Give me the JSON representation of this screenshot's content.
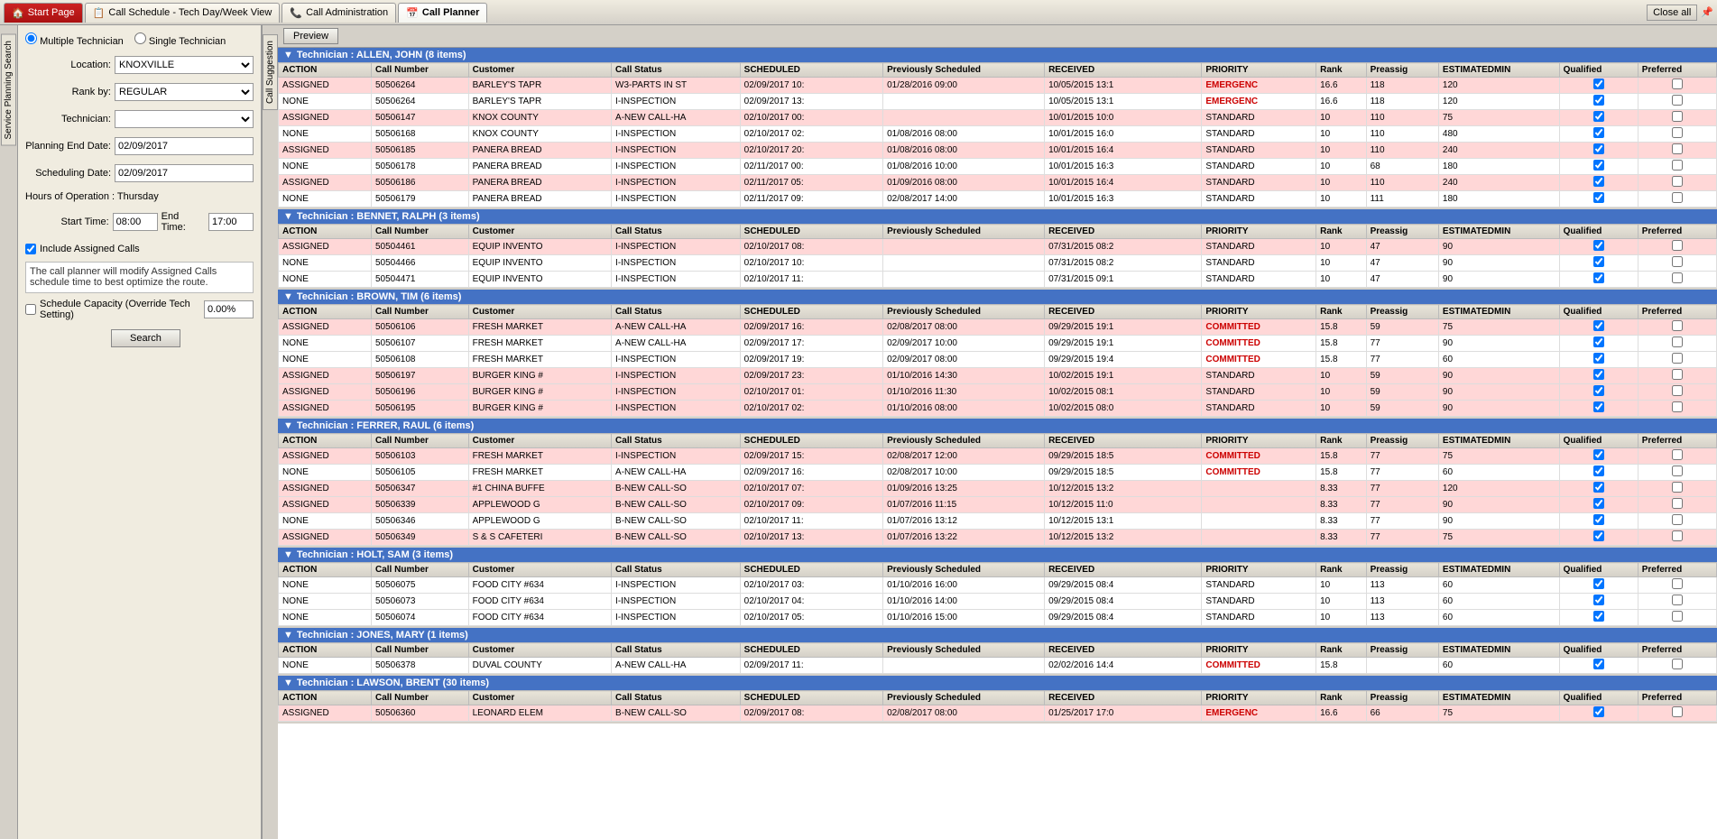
{
  "tabs": [
    {
      "label": "Start Page",
      "id": "start",
      "icon": "🏠",
      "active": false,
      "isStart": true
    },
    {
      "label": "Call Schedule - Tech Day/Week View",
      "id": "callschedule",
      "active": false
    },
    {
      "label": "Call Administration",
      "id": "calladmin",
      "active": false
    },
    {
      "label": "Call Planner",
      "id": "callplanner",
      "active": true
    }
  ],
  "closeAllLabel": "Close all",
  "previewLabel": "Preview",
  "sidebar": {
    "servicePlanning": "Service Planning Search",
    "callSuggestion": "Call Suggestion"
  },
  "leftPanel": {
    "multiTechLabel": "Multiple Technician",
    "singleTechLabel": "Single Technician",
    "locationLabel": "Location:",
    "locationValue": "KNOXVILLE",
    "rankByLabel": "Rank by:",
    "rankByValue": "REGULAR",
    "technicianLabel": "Technician:",
    "planningEndDateLabel": "Planning End Date:",
    "planningEndDateValue": "02/09/2017",
    "schedulingDateLabel": "Scheduling Date:",
    "schedulingDateValue": "02/09/2017",
    "hoursOfOperationLabel": "Hours of Operation : Thursday",
    "startTimeLabel": "Start Time:",
    "startTimeValue": "08:00",
    "endTimeLabel": "End Time:",
    "endTimeValue": "17:00",
    "includeAssignedLabel": "Include Assigned Calls",
    "infoBoxText": "The call planner will modify Assigned Calls schedule time to best optimize the route.",
    "scheduleCapacityLabel": "Schedule Capacity (Override Tech Setting)",
    "scheduleCapacityValue": "0.00%",
    "searchLabel": "Search"
  },
  "technicians": [
    {
      "name": "ALLEN, JOHN",
      "itemCount": 8,
      "rows": [
        {
          "action": "ASSIGNED",
          "callNum": "50506264",
          "customer": "BARLEY'S TAPR",
          "callStatus": "W3-PARTS IN ST",
          "scheduled": "02/09/2017 10:",
          "prevScheduled": "01/28/2016 09:00",
          "received": "10/05/2015 13:1",
          "priority": "EMERGENC",
          "rank": "16.6",
          "preassig": "118",
          "estMin": "120",
          "qualified": true,
          "preferred": false,
          "rowType": "assigned"
        },
        {
          "action": "NONE",
          "callNum": "50506264",
          "customer": "BARLEY'S TAPR",
          "callStatus": "I-INSPECTION",
          "scheduled": "02/09/2017 13:",
          "prevScheduled": "",
          "received": "10/05/2015 13:1",
          "priority": "EMERGENC",
          "rank": "16.6",
          "preassig": "118",
          "estMin": "120",
          "qualified": true,
          "preferred": false,
          "rowType": "none"
        },
        {
          "action": "ASSIGNED",
          "callNum": "50506147",
          "customer": "KNOX COUNTY",
          "callStatus": "A-NEW CALL-HA",
          "scheduled": "02/10/2017 00:",
          "prevScheduled": "",
          "received": "10/01/2015 10:0",
          "priority": "STANDARD",
          "rank": "10",
          "preassig": "110",
          "estMin": "75",
          "qualified": true,
          "preferred": false,
          "rowType": "assigned"
        },
        {
          "action": "NONE",
          "callNum": "50506168",
          "customer": "KNOX COUNTY",
          "callStatus": "I-INSPECTION",
          "scheduled": "02/10/2017 02:",
          "prevScheduled": "01/08/2016 08:00",
          "received": "10/01/2015 16:0",
          "priority": "STANDARD",
          "rank": "10",
          "preassig": "110",
          "estMin": "480",
          "qualified": true,
          "preferred": false,
          "rowType": "none"
        },
        {
          "action": "ASSIGNED",
          "callNum": "50506185",
          "customer": "PANERA BREAD",
          "callStatus": "I-INSPECTION",
          "scheduled": "02/10/2017 20:",
          "prevScheduled": "01/08/2016 08:00",
          "received": "10/01/2015 16:4",
          "priority": "STANDARD",
          "rank": "10",
          "preassig": "110",
          "estMin": "240",
          "qualified": true,
          "preferred": false,
          "rowType": "assigned"
        },
        {
          "action": "NONE",
          "callNum": "50506178",
          "customer": "PANERA BREAD",
          "callStatus": "I-INSPECTION",
          "scheduled": "02/11/2017 00:",
          "prevScheduled": "01/08/2016 10:00",
          "received": "10/01/2015 16:3",
          "priority": "STANDARD",
          "rank": "10",
          "preassig": "68",
          "estMin": "180",
          "qualified": true,
          "preferred": false,
          "rowType": "none"
        },
        {
          "action": "ASSIGNED",
          "callNum": "50506186",
          "customer": "PANERA BREAD",
          "callStatus": "I-INSPECTION",
          "scheduled": "02/11/2017 05:",
          "prevScheduled": "01/09/2016 08:00",
          "received": "10/01/2015 16:4",
          "priority": "STANDARD",
          "rank": "10",
          "preassig": "110",
          "estMin": "240",
          "qualified": true,
          "preferred": false,
          "rowType": "assigned"
        },
        {
          "action": "NONE",
          "callNum": "50506179",
          "customer": "PANERA BREAD",
          "callStatus": "I-INSPECTION",
          "scheduled": "02/11/2017 09:",
          "prevScheduled": "02/08/2017 14:00",
          "received": "10/01/2015 16:3",
          "priority": "STANDARD",
          "rank": "10",
          "preassig": "111",
          "estMin": "180",
          "qualified": true,
          "preferred": false,
          "rowType": "none"
        }
      ]
    },
    {
      "name": "BENNET, RALPH",
      "itemCount": 3,
      "rows": [
        {
          "action": "ASSIGNED",
          "callNum": "50504461",
          "customer": "EQUIP INVENTO",
          "callStatus": "I-INSPECTION",
          "scheduled": "02/10/2017 08:",
          "prevScheduled": "",
          "received": "07/31/2015 08:2",
          "priority": "STANDARD",
          "rank": "10",
          "preassig": "47",
          "estMin": "90",
          "qualified": true,
          "preferred": false,
          "rowType": "assigned"
        },
        {
          "action": "NONE",
          "callNum": "50504466",
          "customer": "EQUIP INVENTO",
          "callStatus": "I-INSPECTION",
          "scheduled": "02/10/2017 10:",
          "prevScheduled": "",
          "received": "07/31/2015 08:2",
          "priority": "STANDARD",
          "rank": "10",
          "preassig": "47",
          "estMin": "90",
          "qualified": true,
          "preferred": false,
          "rowType": "none"
        },
        {
          "action": "NONE",
          "callNum": "50504471",
          "customer": "EQUIP INVENTO",
          "callStatus": "I-INSPECTION",
          "scheduled": "02/10/2017 11:",
          "prevScheduled": "",
          "received": "07/31/2015 09:1",
          "priority": "STANDARD",
          "rank": "10",
          "preassig": "47",
          "estMin": "90",
          "qualified": true,
          "preferred": false,
          "rowType": "none"
        }
      ]
    },
    {
      "name": "BROWN, TIM",
      "itemCount": 6,
      "rows": [
        {
          "action": "ASSIGNED",
          "callNum": "50506106",
          "customer": "FRESH MARKET",
          "callStatus": "A-NEW CALL-HA",
          "scheduled": "02/09/2017 16:",
          "prevScheduled": "02/08/2017 08:00",
          "received": "09/29/2015 19:1",
          "priority": "COMMITTED",
          "rank": "15.8",
          "preassig": "59",
          "estMin": "75",
          "qualified": true,
          "preferred": false,
          "rowType": "assigned"
        },
        {
          "action": "NONE",
          "callNum": "50506107",
          "customer": "FRESH MARKET",
          "callStatus": "A-NEW CALL-HA",
          "scheduled": "02/09/2017 17:",
          "prevScheduled": "02/09/2017 10:00",
          "received": "09/29/2015 19:1",
          "priority": "COMMITTED",
          "rank": "15.8",
          "preassig": "77",
          "estMin": "90",
          "qualified": true,
          "preferred": false,
          "rowType": "none"
        },
        {
          "action": "NONE",
          "callNum": "50506108",
          "customer": "FRESH MARKET",
          "callStatus": "I-INSPECTION",
          "scheduled": "02/09/2017 19:",
          "prevScheduled": "02/09/2017 08:00",
          "received": "09/29/2015 19:4",
          "priority": "COMMITTED",
          "rank": "15.8",
          "preassig": "77",
          "estMin": "60",
          "qualified": true,
          "preferred": false,
          "rowType": "none"
        },
        {
          "action": "ASSIGNED",
          "callNum": "50506197",
          "customer": "BURGER KING #",
          "callStatus": "I-INSPECTION",
          "scheduled": "02/09/2017 23:",
          "prevScheduled": "01/10/2016 14:30",
          "received": "10/02/2015 19:1",
          "priority": "STANDARD",
          "rank": "10",
          "preassig": "59",
          "estMin": "90",
          "qualified": true,
          "preferred": false,
          "rowType": "assigned"
        },
        {
          "action": "ASSIGNED",
          "callNum": "50506196",
          "customer": "BURGER KING #",
          "callStatus": "I-INSPECTION",
          "scheduled": "02/10/2017 01:",
          "prevScheduled": "01/10/2016 11:30",
          "received": "10/02/2015 08:1",
          "priority": "STANDARD",
          "rank": "10",
          "preassig": "59",
          "estMin": "90",
          "qualified": true,
          "preferred": false,
          "rowType": "assigned"
        },
        {
          "action": "ASSIGNED",
          "callNum": "50506195",
          "customer": "BURGER KING #",
          "callStatus": "I-INSPECTION",
          "scheduled": "02/10/2017 02:",
          "prevScheduled": "01/10/2016 08:00",
          "received": "10/02/2015 08:0",
          "priority": "STANDARD",
          "rank": "10",
          "preassig": "59",
          "estMin": "90",
          "qualified": true,
          "preferred": false,
          "rowType": "assigned"
        }
      ]
    },
    {
      "name": "FERRER, RAUL",
      "itemCount": 6,
      "rows": [
        {
          "action": "ASSIGNED",
          "callNum": "50506103",
          "customer": "FRESH MARKET",
          "callStatus": "I-INSPECTION",
          "scheduled": "02/09/2017 15:",
          "prevScheduled": "02/08/2017 12:00",
          "received": "09/29/2015 18:5",
          "priority": "COMMITTED",
          "rank": "15.8",
          "preassig": "77",
          "estMin": "75",
          "qualified": true,
          "preferred": false,
          "rowType": "assigned"
        },
        {
          "action": "NONE",
          "callNum": "50506105",
          "customer": "FRESH MARKET",
          "callStatus": "A-NEW CALL-HA",
          "scheduled": "02/09/2017 16:",
          "prevScheduled": "02/08/2017 10:00",
          "received": "09/29/2015 18:5",
          "priority": "COMMITTED",
          "rank": "15.8",
          "preassig": "77",
          "estMin": "60",
          "qualified": true,
          "preferred": false,
          "rowType": "none"
        },
        {
          "action": "ASSIGNED",
          "callNum": "50506347",
          "customer": "#1 CHINA BUFFE",
          "callStatus": "B-NEW CALL-SO",
          "scheduled": "02/10/2017 07:",
          "prevScheduled": "01/09/2016 13:25",
          "received": "10/12/2015 13:2",
          "priority": "",
          "rank": "8.33",
          "preassig": "77",
          "estMin": "120",
          "qualified": true,
          "preferred": false,
          "rowType": "assigned"
        },
        {
          "action": "ASSIGNED",
          "callNum": "50506339",
          "customer": "APPLEWOOD G",
          "callStatus": "B-NEW CALL-SO",
          "scheduled": "02/10/2017 09:",
          "prevScheduled": "01/07/2016 11:15",
          "received": "10/12/2015 11:0",
          "priority": "",
          "rank": "8.33",
          "preassig": "77",
          "estMin": "90",
          "qualified": true,
          "preferred": false,
          "rowType": "assigned"
        },
        {
          "action": "NONE",
          "callNum": "50506346",
          "customer": "APPLEWOOD G",
          "callStatus": "B-NEW CALL-SO",
          "scheduled": "02/10/2017 11:",
          "prevScheduled": "01/07/2016 13:12",
          "received": "10/12/2015 13:1",
          "priority": "",
          "rank": "8.33",
          "preassig": "77",
          "estMin": "90",
          "qualified": true,
          "preferred": false,
          "rowType": "none"
        },
        {
          "action": "ASSIGNED",
          "callNum": "50506349",
          "customer": "S & S CAFETERI",
          "callStatus": "B-NEW CALL-SO",
          "scheduled": "02/10/2017 13:",
          "prevScheduled": "01/07/2016 13:22",
          "received": "10/12/2015 13:2",
          "priority": "",
          "rank": "8.33",
          "preassig": "77",
          "estMin": "75",
          "qualified": true,
          "preferred": false,
          "rowType": "assigned"
        }
      ]
    },
    {
      "name": "HOLT, SAM",
      "itemCount": 3,
      "rows": [
        {
          "action": "NONE",
          "callNum": "50506075",
          "customer": "FOOD CITY #634",
          "callStatus": "I-INSPECTION",
          "scheduled": "02/10/2017 03:",
          "prevScheduled": "01/10/2016 16:00",
          "received": "09/29/2015 08:4",
          "priority": "STANDARD",
          "rank": "10",
          "preassig": "113",
          "estMin": "60",
          "qualified": true,
          "preferred": false,
          "rowType": "none"
        },
        {
          "action": "NONE",
          "callNum": "50506073",
          "customer": "FOOD CITY #634",
          "callStatus": "I-INSPECTION",
          "scheduled": "02/10/2017 04:",
          "prevScheduled": "01/10/2016 14:00",
          "received": "09/29/2015 08:4",
          "priority": "STANDARD",
          "rank": "10",
          "preassig": "113",
          "estMin": "60",
          "qualified": true,
          "preferred": false,
          "rowType": "none"
        },
        {
          "action": "NONE",
          "callNum": "50506074",
          "customer": "FOOD CITY #634",
          "callStatus": "I-INSPECTION",
          "scheduled": "02/10/2017 05:",
          "prevScheduled": "01/10/2016 15:00",
          "received": "09/29/2015 08:4",
          "priority": "STANDARD",
          "rank": "10",
          "preassig": "113",
          "estMin": "60",
          "qualified": true,
          "preferred": false,
          "rowType": "none"
        }
      ]
    },
    {
      "name": "JONES, MARY",
      "itemCount": 1,
      "rows": [
        {
          "action": "NONE",
          "callNum": "50506378",
          "customer": "DUVAL COUNTY",
          "callStatus": "A-NEW CALL-HA",
          "scheduled": "02/09/2017 11:",
          "prevScheduled": "",
          "received": "02/02/2016 14:4",
          "priority": "COMMITTED",
          "rank": "15.8",
          "preassig": "",
          "estMin": "60",
          "qualified": true,
          "preferred": false,
          "rowType": "none"
        }
      ]
    },
    {
      "name": "LAWSON, BRENT",
      "itemCount": 30,
      "rows": [
        {
          "action": "ASSIGNED",
          "callNum": "50506360",
          "customer": "LEONARD ELEM",
          "callStatus": "B-NEW CALL-SO",
          "scheduled": "02/09/2017 08:",
          "prevScheduled": "02/08/2017 08:00",
          "received": "01/25/2017 17:0",
          "priority": "EMERGENC",
          "rank": "16.6",
          "preassig": "66",
          "estMin": "75",
          "qualified": true,
          "preferred": false,
          "rowType": "assigned"
        }
      ]
    }
  ],
  "tableHeaders": {
    "action": "ACTION",
    "callNumber": "Call Number",
    "customer": "Customer",
    "callStatus": "Call Status",
    "scheduled": "SCHEDULED",
    "prevScheduled": "Previously Scheduled",
    "received": "RECEIVED",
    "priority": "PRIORITY",
    "rank": "Rank",
    "preassig": "Preassig",
    "estimatedMin": "ESTIMATEDMIN",
    "qualified": "Qualified",
    "preferred": "Preferred"
  },
  "colors": {
    "techHeaderBg": "#4472C4",
    "rowAssigned": "#ffd7d7",
    "rowNone": "#ffffff",
    "committed": "#cc0000"
  }
}
